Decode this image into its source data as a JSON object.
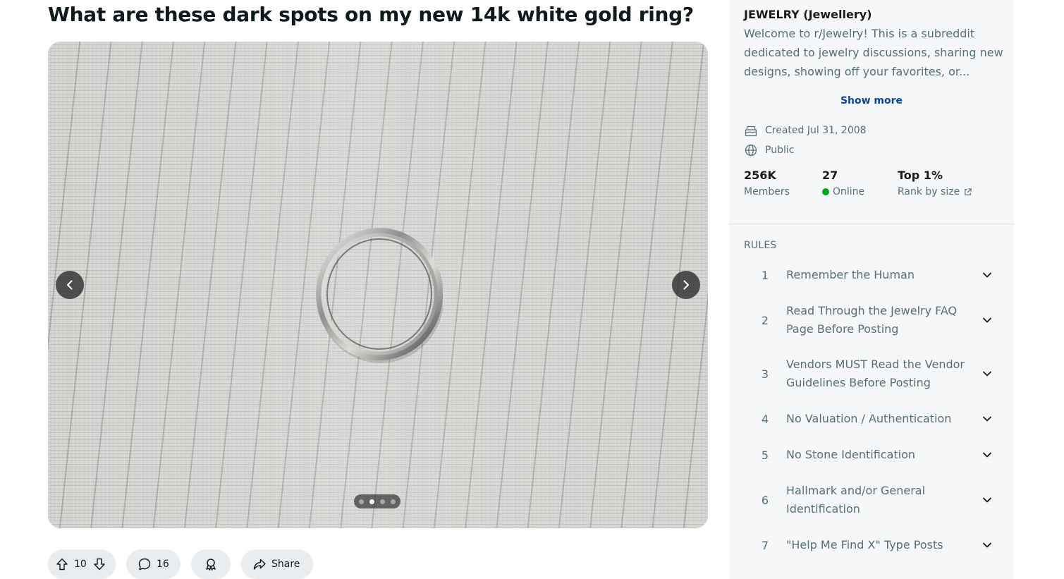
{
  "post": {
    "title": "What are these dark spots on my new 14k white gold ring?",
    "media": {
      "image_alt": "white gold ring on textured fabric",
      "slide_count": 4,
      "active_slide": 2
    },
    "actions": {
      "upvotes": "10",
      "comments": "16",
      "share_label": "Share"
    }
  },
  "sidebar": {
    "community_name": "JEWELRY (Jewellery)",
    "description": "Welcome to r/Jewelry! This is a subreddit dedicated to jewelry discussions, sharing new designs, showing off your favorites, or...",
    "show_more": "Show more",
    "created": "Created Jul 31, 2008",
    "visibility": "Public",
    "stats": {
      "members_value": "256K",
      "members_label": "Members",
      "online_value": "27",
      "online_label": "Online",
      "rank_value": "Top 1%",
      "rank_label": "Rank by size"
    },
    "rules_heading": "RULES",
    "rules": [
      {
        "num": "1",
        "text": "Remember the Human"
      },
      {
        "num": "2",
        "text": "Read Through the Jewelry FAQ Page Before Posting"
      },
      {
        "num": "3",
        "text": "Vendors MUST Read the Vendor Guidelines Before Posting"
      },
      {
        "num": "4",
        "text": "No Valuation / Authentication"
      },
      {
        "num": "5",
        "text": "No Stone Identification"
      },
      {
        "num": "6",
        "text": "Hallmark and/or General Identification"
      },
      {
        "num": "7",
        "text": "\"Help Me Find X\" Type Posts"
      }
    ]
  },
  "colors": {
    "link": "#0a449b",
    "muted_text": "#576f76",
    "online": "#01a816",
    "pill_bg": "#eaedef",
    "sidebar_bg": "#f6f7f8"
  }
}
